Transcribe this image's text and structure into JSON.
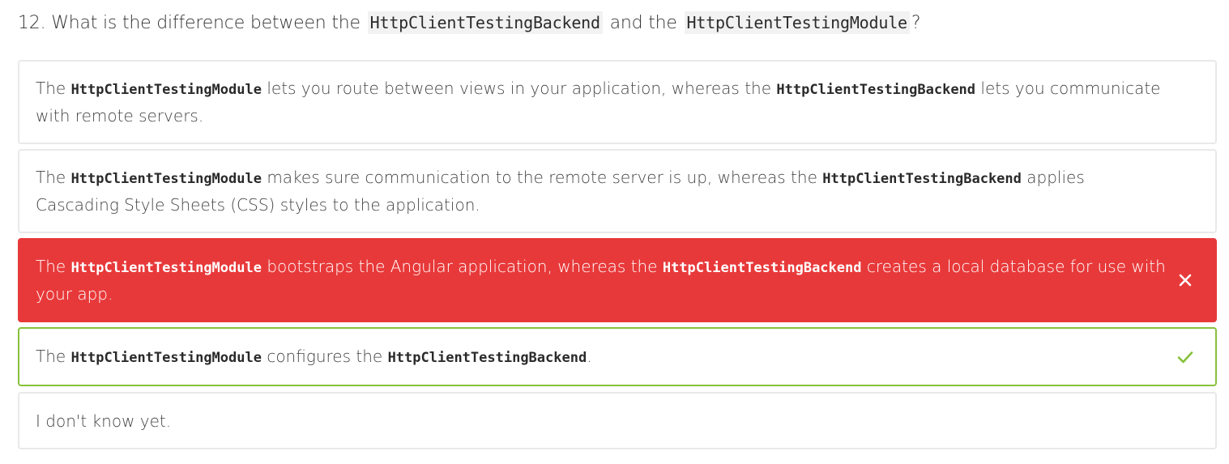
{
  "question": {
    "number": "12.",
    "pre": "What is the difference between the",
    "code1": "HttpClientTestingBackend",
    "mid": "and the",
    "code2": "HttpClientTestingModule",
    "post": "?"
  },
  "options": [
    {
      "t1": "The",
      "c1": "HttpClientTestingModule",
      "t2": "lets you route between views in your application, whereas the",
      "c2": "HttpClientTestingBackend",
      "t3": "lets you communicate with remote servers.",
      "state": "neutral"
    },
    {
      "t1": "The",
      "c1": "HttpClientTestingModule",
      "t2": "makes sure communication to the remote server is up, whereas the",
      "c2": "HttpClientTestingBackend",
      "t3": "applies Cascading Style Sheets (CSS) styles to the application.",
      "state": "neutral"
    },
    {
      "t1": "The",
      "c1": "HttpClientTestingModule",
      "t2": "bootstraps the Angular application, whereas the",
      "c2": "HttpClientTestingBackend",
      "t3": "creates a local database for use with your app.",
      "state": "incorrect",
      "icon": "close-icon"
    },
    {
      "t1": "The",
      "c1": "HttpClientTestingModule",
      "t2": "configures the",
      "c2": "HttpClientTestingBackend",
      "t3": ".",
      "state": "correct",
      "icon": "check-icon"
    },
    {
      "t1": "I don't know yet.",
      "state": "neutral"
    }
  ],
  "colors": {
    "incorrect": "#e8393a",
    "correct": "#86c23a",
    "border": "#e9e9e9"
  }
}
